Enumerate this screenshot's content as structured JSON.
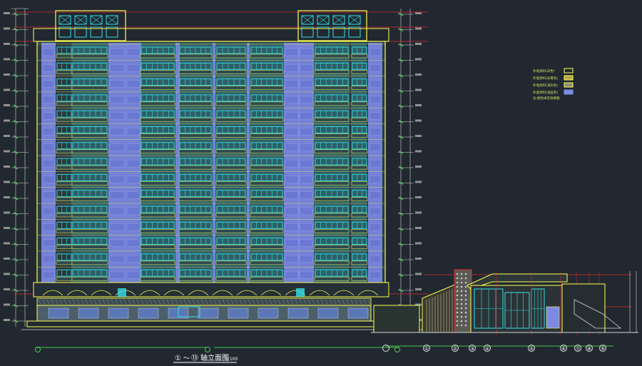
{
  "drawing": {
    "title": "①～⑬轴立面图",
    "title_start_marker": "①",
    "title_end_marker": "⑬",
    "title_rest": "轴立面图",
    "scale": "1:100"
  },
  "legend": {
    "items": [
      {
        "label": "外墙涂料(白色)",
        "swatch_color": "#1f2a30",
        "swatch_border": "#ffff55"
      },
      {
        "label": "外墙涂料(米黄色)",
        "swatch_color": "#b8a848",
        "swatch_border": "#ffff55"
      },
      {
        "label": "外墙涂料(浅灰色)",
        "swatch_color": "#8d8d7a",
        "swatch_border": "#ffff55"
      },
      {
        "label": "外墙涂料(浅蓝色)",
        "swatch_color": "#7c8ae6",
        "swatch_border": "#7c8ae6"
      }
    ],
    "note": "注:颜色详见效果图"
  },
  "axis_labels": [
    "①",
    "②",
    "③",
    "④",
    "⑤",
    "⑥",
    "⑦",
    "⑧",
    "⑨"
  ],
  "colors": {
    "background": "#212830",
    "outline_yellow": "#ffff55",
    "glass_cyan": "#33e0e8",
    "panel_blue": "#7c8ae6",
    "balcony_teal": "#3aa6b0",
    "accent_red": "#e02a2a",
    "dimension_white": "#d8d8d8",
    "dimension_green": "#55ff55"
  }
}
